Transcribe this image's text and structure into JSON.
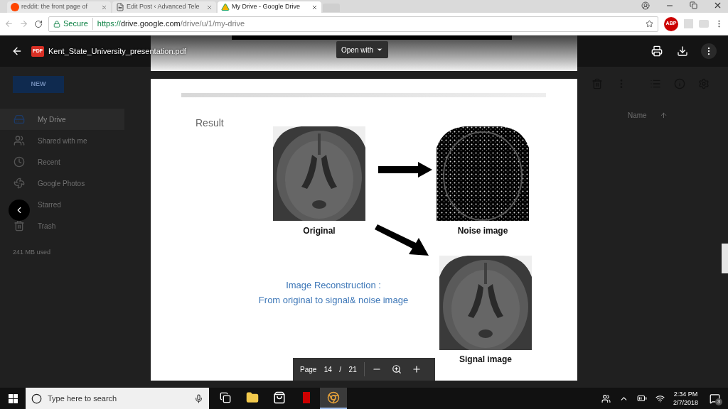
{
  "browser": {
    "tabs": [
      {
        "title": "reddit: the front page of",
        "selected": false
      },
      {
        "title": "Edit Post ‹ Advanced Tele",
        "selected": false
      },
      {
        "title": "My Drive - Google Drive",
        "selected": true
      }
    ],
    "security": "Secure",
    "url_scheme": "https://",
    "url_host": "drive.google.com",
    "url_path": "/drive/u/1/my-drive",
    "adblock_badge": "ABP"
  },
  "drive": {
    "new_button": "NEW",
    "sidebar": [
      {
        "label": "My Drive",
        "selected": true
      },
      {
        "label": "Shared with me",
        "selected": false
      },
      {
        "label": "Recent",
        "selected": false
      },
      {
        "label": "Google Photos",
        "selected": false
      },
      {
        "label": "Starred",
        "selected": false
      },
      {
        "label": "Trash",
        "selected": false
      }
    ],
    "storage": "241 MB used",
    "sort_column": "Name"
  },
  "viewer": {
    "file_name": "Kent_State_University_presentation.pdf",
    "file_badge": "PDF",
    "open_with": "Open with",
    "slide": {
      "heading": "Result",
      "images": [
        {
          "caption": "Original",
          "noisy": false
        },
        {
          "caption": "Noise image",
          "noisy": true
        },
        {
          "caption": "Signal image",
          "noisy": false
        }
      ],
      "note": [
        "Image Reconstruction :",
        "From original to signal& noise image"
      ]
    },
    "pager": {
      "label": "Page",
      "current": "14",
      "separator": "/",
      "total": "21"
    }
  },
  "taskbar": {
    "search_placeholder": "Type here to search",
    "apps": [
      {
        "kind": "taskview",
        "selected": false
      },
      {
        "kind": "explorer",
        "selected": false
      },
      {
        "kind": "store",
        "selected": false
      },
      {
        "kind": "netflix",
        "selected": false
      },
      {
        "kind": "chrome",
        "selected": true
      }
    ],
    "time": "2:34 PM",
    "date": "2/7/2018",
    "notifications": "3"
  }
}
